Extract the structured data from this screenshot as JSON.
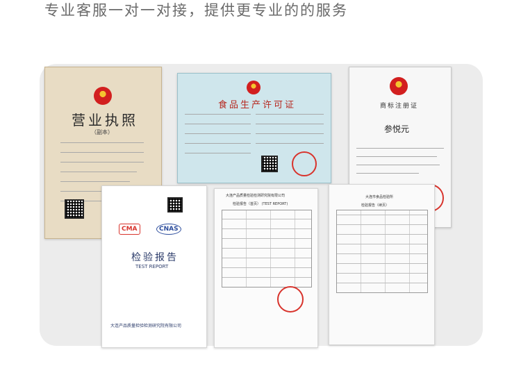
{
  "headline": "专业客服一对一对接，提供更专业的的服务",
  "documents": {
    "business_license": {
      "title": "营业执照",
      "copy_label": "（副本）"
    },
    "food_license": {
      "title": "食品生产许可证"
    },
    "trademark": {
      "title": "商标注册证",
      "mark": "参悦元"
    },
    "test_report": {
      "title": "检验报告",
      "title_en": "TEST REPORT",
      "cma": "CMA",
      "cnas": "CNAS",
      "institute": "大连产品质量检验检测研究院有限公司"
    },
    "report_page_1": {
      "header": "大连产品质量检验检测研究院有限公司",
      "subtitle": "检验报告（首页） (TEST REPORT)"
    },
    "report_page_2": {
      "header": "大连市食品检验所",
      "subtitle": "检验报告（续页）"
    }
  }
}
